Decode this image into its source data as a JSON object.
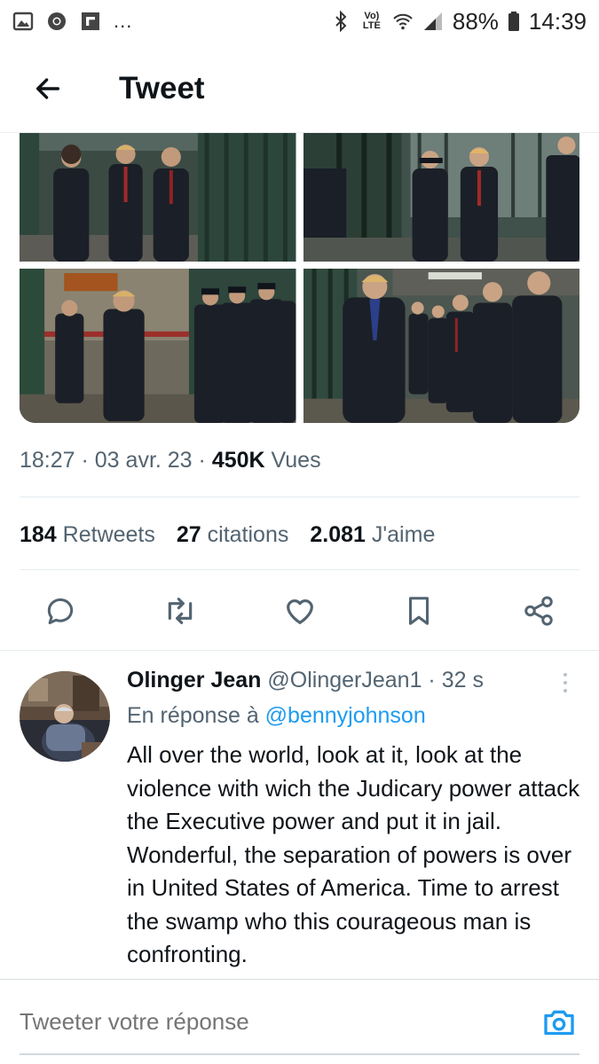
{
  "status_bar": {
    "left_icons": [
      "gallery-icon",
      "chrome-icon",
      "flipboard-icon"
    ],
    "more": "...",
    "volte": "Vo) LTE",
    "battery": "88%",
    "time": "14:39"
  },
  "header": {
    "title": "Tweet"
  },
  "media": {
    "photo_count": 4
  },
  "tweet_meta": {
    "time": "18:27",
    "sep1": " · ",
    "date": "03 avr. 23",
    "sep2": " · ",
    "views_count": "450K",
    "views_label": " Vues"
  },
  "stats": {
    "retweets_count": "184",
    "retweets_label": " Retweets",
    "quotes_count": "27",
    "quotes_label": " citations",
    "likes_count": "2.081",
    "likes_label": " J'aime"
  },
  "actions": [
    "reply-icon",
    "retweet-icon",
    "like-icon",
    "bookmark-icon",
    "share-icon"
  ],
  "reply": {
    "name": "Olinger Jean",
    "handle": " @OlingerJean1",
    "sep": " · ",
    "time": "32 s",
    "reply_to_label": "En réponse à ",
    "reply_to_handle": "@bennyjohnson",
    "text": "All over the world, look at it, look at the violence with wich the Judicary power attack the Executive power and put it in jail. Wonderful, the separation of powers is over in United States of America. Time to arrest the swamp who this courageous man is confronting."
  },
  "compose": {
    "placeholder": "Tweeter votre réponse"
  },
  "colors": {
    "accent": "#1d9bf0",
    "text_primary": "#0f1419",
    "text_secondary": "#536471"
  }
}
